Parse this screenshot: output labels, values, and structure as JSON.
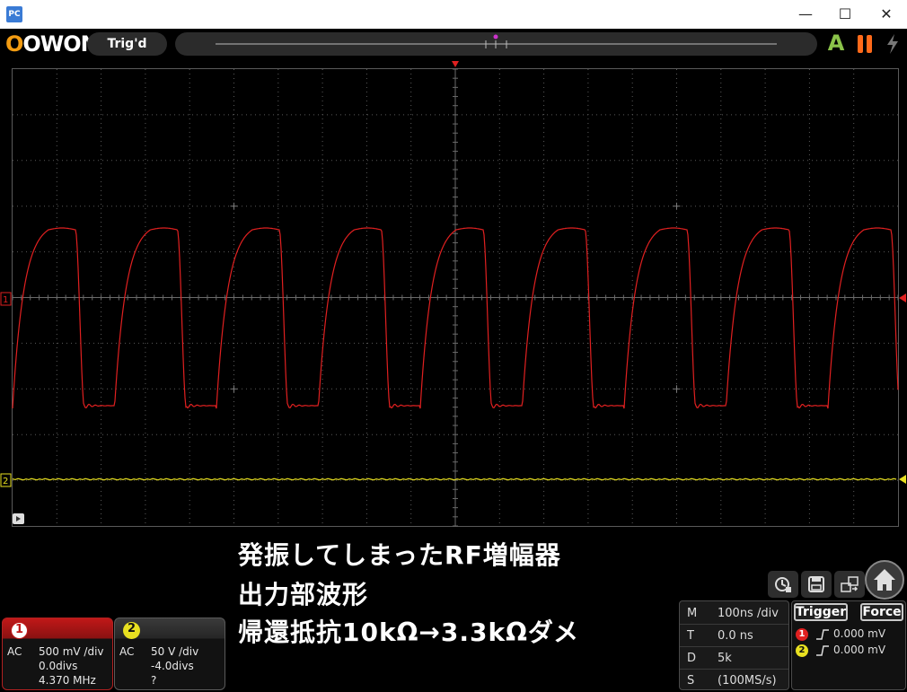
{
  "app": {
    "icon_label": "PC",
    "icon_color": "#3a7bd5"
  },
  "window_controls": {
    "minimize": "—",
    "maximize": "☐",
    "close": "✕"
  },
  "toolbar": {
    "logo": "OWON",
    "trigger_status": "Trig'd",
    "auto_label": "A",
    "run_stop": "pause-icon",
    "single_trigger": "lightning-icon"
  },
  "colors": {
    "ch1": "#e02020",
    "ch2": "#e8e020",
    "grid": "#5a5a5a",
    "logo_orange": "#f39c12",
    "auto_green": "#8bc34a",
    "pause_orange": "#ff6a1a"
  },
  "scope": {
    "ch1_marker": "1",
    "ch2_marker": "2",
    "grid": true
  },
  "note": {
    "line1": "発振してしまったRF増幅器",
    "line2": "出力部波形",
    "line3": "帰還抵抗10kΩ→3.3kΩダメ"
  },
  "ch1": {
    "badge": "1",
    "coupling": "AC",
    "scale": "500 mV /div",
    "offset": "0.0divs",
    "freq": "4.370 MHz"
  },
  "ch2": {
    "badge": "2",
    "coupling": "AC",
    "scale": "50 V /div",
    "offset": "-4.0divs",
    "freq": "?"
  },
  "timebase": {
    "rows": [
      {
        "key": "M",
        "value": "100ns /div"
      },
      {
        "key": "T",
        "value": "0.0 ns"
      },
      {
        "key": "D",
        "value": "5k"
      },
      {
        "key": "S",
        "value": "(100MS/s)"
      }
    ]
  },
  "trigger": {
    "trigger_label": "Trigger",
    "force_label": "Force",
    "ch1_level": "0.000 mV",
    "ch2_level": "0.000 mV"
  },
  "tools": [
    "cursor-icon",
    "save-icon",
    "swap-icon"
  ],
  "home_icon": "home-icon"
}
